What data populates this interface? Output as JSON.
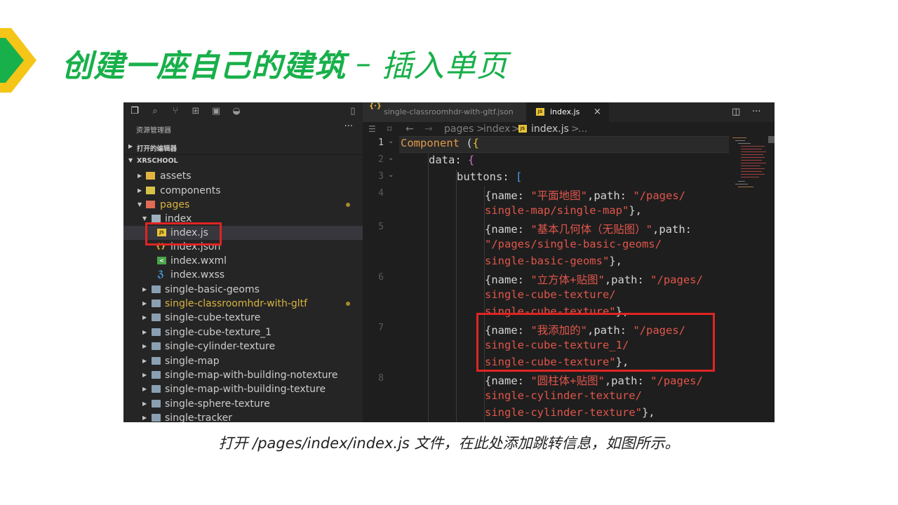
{
  "slide": {
    "title": "创建一座自己的建筑",
    "separator": "–",
    "subtitle": "插入单页",
    "caption": "打开 /pages/index/index.js 文件，在此处添加跳转信息，如图所示。",
    "accent_color": "#18b04a",
    "chevron_colors": [
      "#18b04a",
      "#f5c518"
    ]
  },
  "sidebar": {
    "activity_icons": [
      "files-icon",
      "search-icon",
      "source-control-icon",
      "extensions-icon",
      "remote-icon",
      "docker-icon"
    ],
    "header": "资源管理器",
    "more": "···",
    "sections": {
      "open_editors": "打开的编辑器",
      "project": "XRSCHOOL"
    },
    "tree": [
      {
        "name": "assets",
        "icon": "folder-icon",
        "expanded": false
      },
      {
        "name": "components",
        "icon": "folder-icon",
        "expanded": false
      },
      {
        "name": "pages",
        "icon": "folder-icon",
        "expanded": true,
        "modified": true
      },
      {
        "name": "index",
        "icon": "folder-open-icon",
        "expanded": true
      },
      {
        "name": "index.js",
        "icon": "js-file-icon",
        "selected": true
      },
      {
        "name": "index.json",
        "icon": "json-file-icon"
      },
      {
        "name": "index.wxml",
        "icon": "wxml-file-icon"
      },
      {
        "name": "index.wxss",
        "icon": "css-file-icon"
      },
      {
        "name": "single-basic-geoms",
        "icon": "folder-icon"
      },
      {
        "name": "single-classroomhdr-with-gltf",
        "icon": "folder-icon",
        "modified": true
      },
      {
        "name": "single-cube-texture",
        "icon": "folder-icon"
      },
      {
        "name": "single-cube-texture_1",
        "icon": "folder-icon"
      },
      {
        "name": "single-cylinder-texture",
        "icon": "folder-icon"
      },
      {
        "name": "single-map",
        "icon": "folder-icon"
      },
      {
        "name": "single-map-with-building-notexture",
        "icon": "folder-icon"
      },
      {
        "name": "single-map-with-building-texture",
        "icon": "folder-icon"
      },
      {
        "name": "single-sphere-texture",
        "icon": "folder-icon"
      },
      {
        "name": "single-tracker",
        "icon": "folder-icon"
      }
    ]
  },
  "editor": {
    "tabs": [
      {
        "label": "single-classroomhdr-with-gltf.json",
        "icon": "json-file-icon",
        "active": false
      },
      {
        "label": "index.js",
        "icon": "js-file-icon",
        "active": true,
        "close": "×"
      }
    ],
    "breadcrumb": [
      "pages",
      "index",
      "index.js",
      "..."
    ],
    "breadcrumb_separator": ">",
    "line_numbers": [
      "1",
      "2",
      "3",
      "4",
      "5",
      "6",
      "7",
      "8"
    ],
    "code": {
      "l1_kw": "Component",
      "l1_rest": " (",
      "l1_brace": "{",
      "l2_prop": "data",
      "l2_rest": ": ",
      "l2_brace": "{",
      "l3_prop": "buttons",
      "l3_rest": ": ",
      "l3_brk": "[",
      "l4a_pre": "{name: ",
      "l4a_str": "\"平面地图\"",
      "l4a_mid": ",path: ",
      "l4a_str2": "\"/pages/",
      "l4b_str": "single-map/single-map\"",
      "l4b_post": "},",
      "l5a_pre": "{name: ",
      "l5a_str": "\"基本几何体（无贴图）\"",
      "l5a_mid": ",path:",
      "l5b_str": "\"/pages/single-basic-geoms/",
      "l5c_str": "single-basic-geoms\"",
      "l5c_post": "},",
      "l6a_pre": "{name: ",
      "l6a_str": "\"立方体+贴图\"",
      "l6a_mid": ",path: ",
      "l6a_str2": "\"/pages/",
      "l6b_str": "single-cube-texture/",
      "l6c_str": "single-cube-texture\"",
      "l6c_post": "},",
      "l7a_pre": "{name: ",
      "l7a_str": "\"我添加的\"",
      "l7a_mid": ",path: ",
      "l7a_str2": "\"/pages/",
      "l7b_str": "single-cube-texture_1/",
      "l7c_str": "single-cube-texture\"",
      "l7c_post": "},",
      "l8a_pre": "{name: ",
      "l8a_str": "\"圆柱体+贴图\"",
      "l8a_mid": ",path: ",
      "l8a_str2": "\"/pages/",
      "l8b_str": "single-cylinder-texture/",
      "l8c_str": "single-cylinder-texture\"",
      "l8c_post": "},"
    }
  }
}
